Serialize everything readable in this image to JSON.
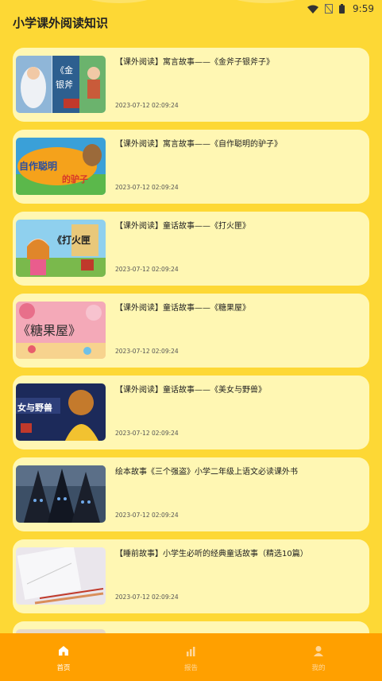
{
  "status_bar": {
    "time": "9:59"
  },
  "header": {
    "title": "小学课外阅读知识"
  },
  "articles": [
    {
      "title": "【课外阅读】寓言故事——《金斧子银斧子》",
      "date": "2023-07-12 02:09:24",
      "thumb_text": "《金斧子银斧子》"
    },
    {
      "title": "【课外阅读】寓言故事——《自作聪明的驴子》",
      "date": "2023-07-12 02:09:24",
      "thumb_text": "自作聪明的驴子"
    },
    {
      "title": "【课外阅读】童话故事——《打火匣》",
      "date": "2023-07-12 02:09:24",
      "thumb_text": "《打火匣"
    },
    {
      "title": "【课外阅读】童话故事——《糖果屋》",
      "date": "2023-07-12 02:09:24",
      "thumb_text": "《糖果屋》"
    },
    {
      "title": "【课外阅读】童话故事——《美女与野兽》",
      "date": "2023-07-12 02:09:24",
      "thumb_text": "女与野兽"
    },
    {
      "title": "绘本故事《三个强盗》小学二年级上语文必读课外书",
      "date": "2023-07-12 02:09:24",
      "thumb_text": ""
    },
    {
      "title": "【睡前故事】小学生必听的经典童话故事（精选10篇）",
      "date": "2023-07-12 02:09:24",
      "thumb_text": ""
    }
  ],
  "tabs": [
    {
      "label": "首页",
      "icon": "home-icon",
      "active": true
    },
    {
      "label": "报告",
      "icon": "chart-icon",
      "active": false
    },
    {
      "label": "我的",
      "icon": "user-icon",
      "active": false
    }
  ],
  "colors": {
    "background": "#fdd835",
    "card": "#fff7b3",
    "tab_bar": "#ffa000"
  }
}
